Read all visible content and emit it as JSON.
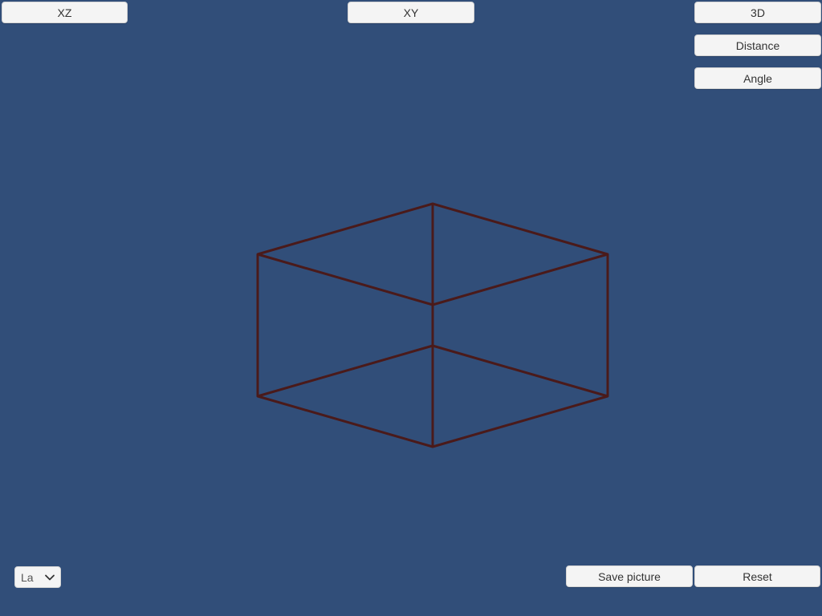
{
  "toolbar": {
    "xz_label": "XZ",
    "xy_label": "XY",
    "view3d_label": "3D",
    "distance_label": "Distance",
    "angle_label": "Angle"
  },
  "footer": {
    "save_label": "Save picture",
    "reset_label": "Reset",
    "language_value": "La"
  },
  "colors": {
    "background": "#314e79",
    "wireframe": "#4a1a1a",
    "button_bg": "#f4f4f4"
  },
  "icons": {
    "dropdown": "chevron-down-icon"
  }
}
